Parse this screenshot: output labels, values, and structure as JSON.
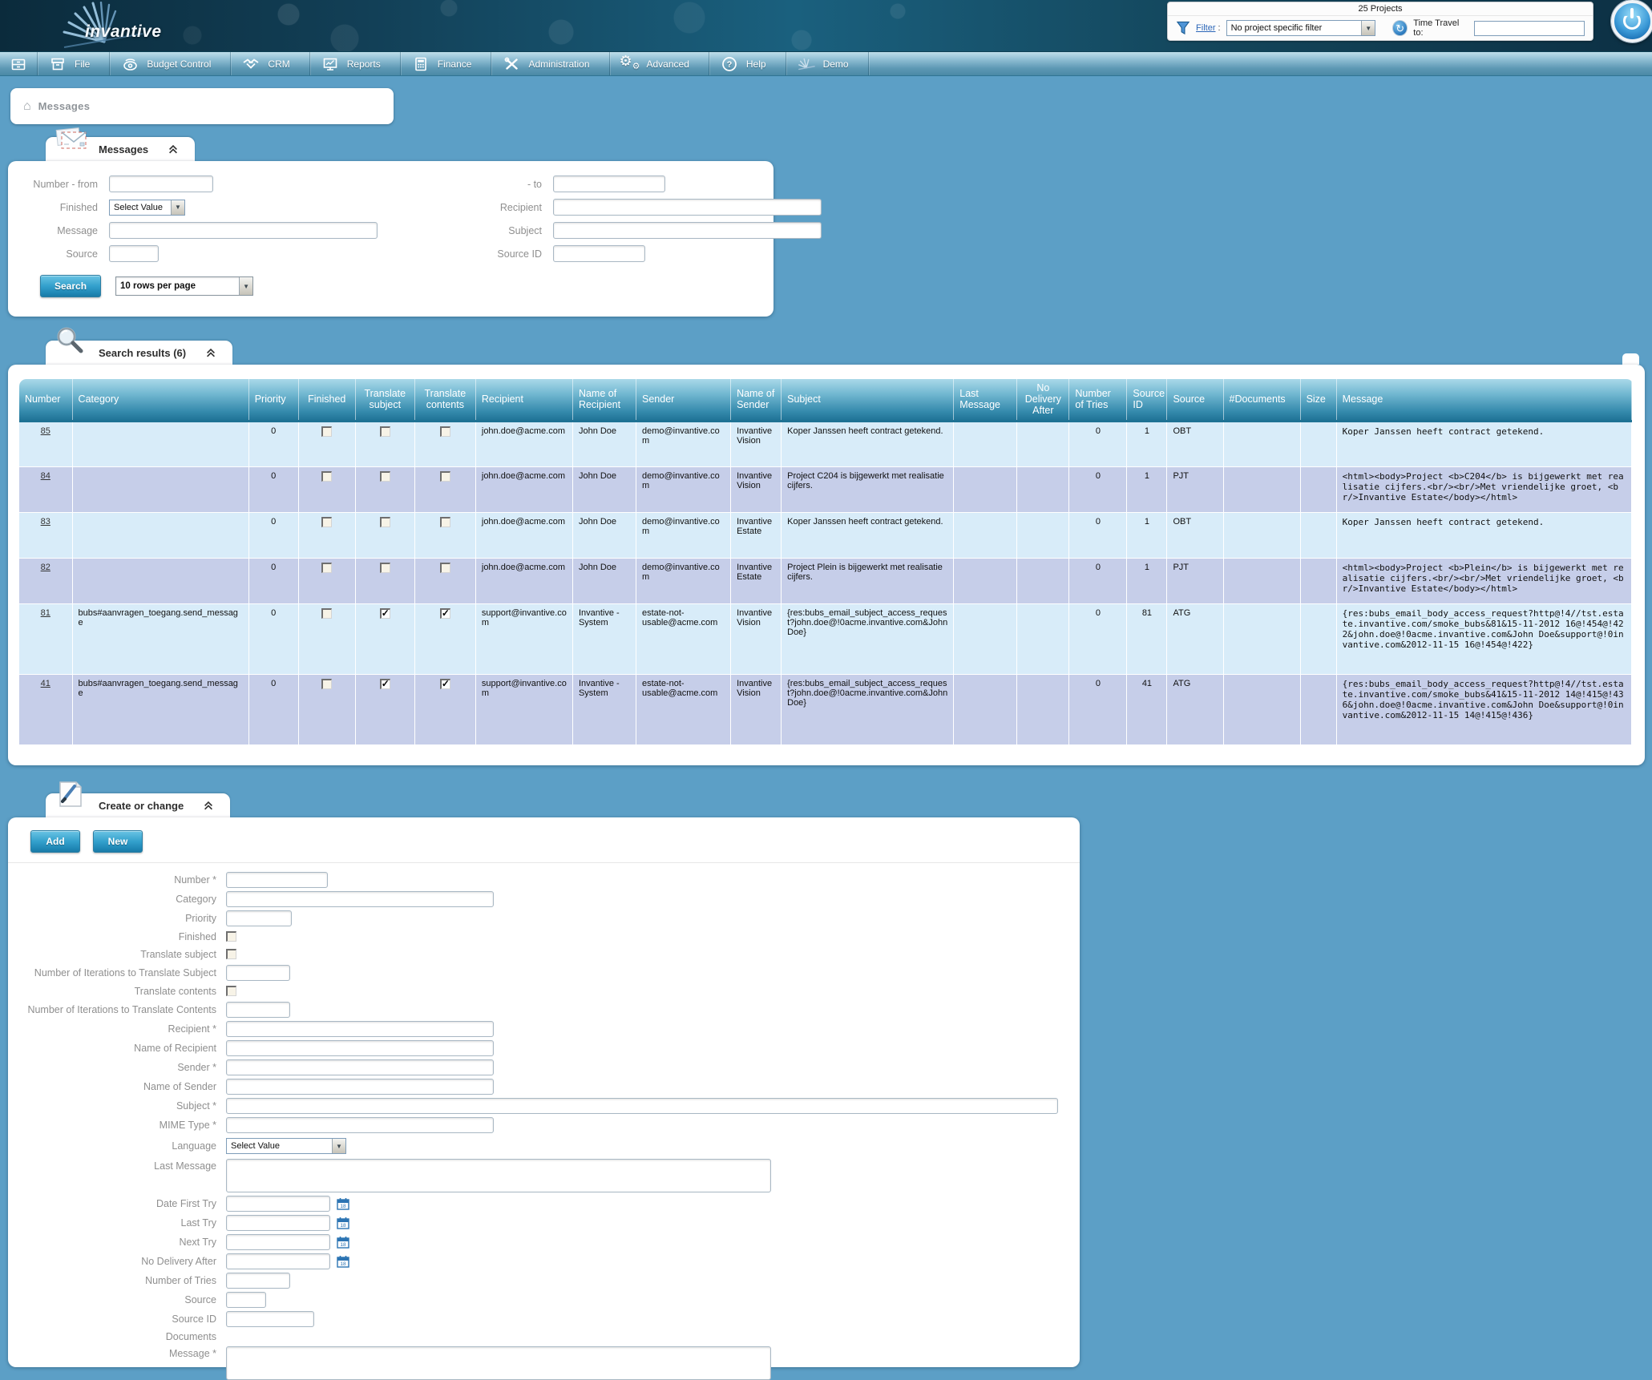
{
  "header": {
    "logo_text": "invantive",
    "projects_count": "25 Projects",
    "filter_label": "Filter",
    "filter_colon": ":",
    "filter_value": "No project specific filter",
    "time_travel_label": "Time Travel to:",
    "time_travel_value": ""
  },
  "menu": {
    "items": [
      {
        "label": "File",
        "icon": "file-icon"
      },
      {
        "label": "Budget Control",
        "icon": "budget-control-icon"
      },
      {
        "label": "CRM",
        "icon": "crm-icon"
      },
      {
        "label": "Reports",
        "icon": "reports-icon"
      },
      {
        "label": "Finance",
        "icon": "finance-icon"
      },
      {
        "label": "Administration",
        "icon": "administration-icon"
      },
      {
        "label": "Advanced",
        "icon": "advanced-icon"
      },
      {
        "label": "Help",
        "icon": "help-icon"
      },
      {
        "label": "Demo",
        "icon": "demo-icon"
      }
    ]
  },
  "breadcrumb": {
    "label": "Messages"
  },
  "search_panel": {
    "title": "Messages",
    "number_from_label": "Number - from",
    "to_label": "- to",
    "finished_label": "Finished",
    "finished_value": "Select Value",
    "recipient_label": "Recipient",
    "message_label": "Message",
    "subject_label": "Subject",
    "source_label": "Source",
    "source_id_label": "Source ID",
    "search_button": "Search",
    "rows_per_page": "10 rows per page"
  },
  "results_panel": {
    "title": "Search results (6)",
    "columns": [
      "Number",
      "Category",
      "Priority",
      "Finished",
      "Translate subject",
      "Translate contents",
      "Recipient",
      "Name of Recipient",
      "Sender",
      "Name of Sender",
      "Subject",
      "Last Message",
      "No Delivery After",
      "Number of Tries",
      "Source ID",
      "Source",
      "#Documents",
      "Size",
      "Message"
    ],
    "rows": [
      {
        "number": "85",
        "category": "",
        "priority": "0",
        "finished": false,
        "translate_subject": false,
        "translate_contents": false,
        "recipient": "john.doe@acme.com",
        "name_of_recipient": "John Doe",
        "sender": "demo@invantive.com",
        "name_of_sender": "Invantive Vision",
        "subject": "Koper Janssen heeft contract getekend.",
        "last_message": "",
        "no_delivery_after": "",
        "number_of_tries": "0",
        "source_id": "1",
        "source": "OBT",
        "documents": "",
        "size": "",
        "message": "Koper Janssen heeft contract getekend."
      },
      {
        "number": "84",
        "category": "",
        "priority": "0",
        "finished": false,
        "translate_subject": false,
        "translate_contents": false,
        "recipient": "john.doe@acme.com",
        "name_of_recipient": "John Doe",
        "sender": "demo@invantive.com",
        "name_of_sender": "Invantive Vision",
        "subject": "Project C204 is bijgewerkt met realisatie cijfers.",
        "last_message": "",
        "no_delivery_after": "",
        "number_of_tries": "0",
        "source_id": "1",
        "source": "PJT",
        "documents": "",
        "size": "",
        "message": "<html><body>Project <b>C204</b> is bijgewerkt met realisatie cijfers.<br/><br/>Met vriendelijke groet, <br/>Invantive Estate</body></html>"
      },
      {
        "number": "83",
        "category": "",
        "priority": "0",
        "finished": false,
        "translate_subject": false,
        "translate_contents": false,
        "recipient": "john.doe@acme.com",
        "name_of_recipient": "John Doe",
        "sender": "demo@invantive.com",
        "name_of_sender": "Invantive Estate",
        "subject": "Koper Janssen heeft contract getekend.",
        "last_message": "",
        "no_delivery_after": "",
        "number_of_tries": "0",
        "source_id": "1",
        "source": "OBT",
        "documents": "",
        "size": "",
        "message": "Koper Janssen heeft contract getekend."
      },
      {
        "number": "82",
        "category": "",
        "priority": "0",
        "finished": false,
        "translate_subject": false,
        "translate_contents": false,
        "recipient": "john.doe@acme.com",
        "name_of_recipient": "John Doe",
        "sender": "demo@invantive.com",
        "name_of_sender": "Invantive Estate",
        "subject": "Project Plein is bijgewerkt met realisatie cijfers.",
        "last_message": "",
        "no_delivery_after": "",
        "number_of_tries": "0",
        "source_id": "1",
        "source": "PJT",
        "documents": "",
        "size": "",
        "message": "<html><body>Project <b>Plein</b> is bijgewerkt met realisatie cijfers.<br/><br/>Met vriendelijke groet, <br/>Invantive Estate</body></html>"
      },
      {
        "number": "81",
        "category": "bubs#aanvragen_toegang.send_message",
        "priority": "0",
        "finished": false,
        "translate_subject": true,
        "translate_contents": true,
        "recipient": "support@invantive.com",
        "name_of_recipient": "Invantive - System",
        "sender": "estate-not-usable@acme.com",
        "name_of_sender": "Invantive Vision",
        "subject": "{res:bubs_email_subject_access_request?john.doe@!0acme.invantive.com&John Doe}",
        "last_message": "",
        "no_delivery_after": "",
        "number_of_tries": "0",
        "source_id": "81",
        "source": "ATG",
        "documents": "",
        "size": "",
        "message": "{res:bubs_email_body_access_request?http@!4//tst.estate.invantive.com/smoke_bubs&81&15-11-2012 16@!454@!422&john.doe@!0acme.invantive.com&John Doe&support@!0invantive.com&2012-11-15 16@!454@!422}"
      },
      {
        "number": "41",
        "category": "bubs#aanvragen_toegang.send_message",
        "priority": "0",
        "finished": false,
        "translate_subject": true,
        "translate_contents": true,
        "recipient": "support@invantive.com",
        "name_of_recipient": "Invantive - System",
        "sender": "estate-not-usable@acme.com",
        "name_of_sender": "Invantive Vision",
        "subject": "{res:bubs_email_subject_access_request?john.doe@!0acme.invantive.com&John Doe}",
        "last_message": "",
        "no_delivery_after": "",
        "number_of_tries": "0",
        "source_id": "41",
        "source": "ATG",
        "documents": "",
        "size": "",
        "message": "{res:bubs_email_body_access_request?http@!4//tst.estate.invantive.com/smoke_bubs&41&15-11-2012 14@!415@!436&john.doe@!0acme.invantive.com&John Doe&support@!0invantive.com&2012-11-15 14@!415@!436}"
      }
    ]
  },
  "create_panel": {
    "title": "Create or change",
    "add_button": "Add",
    "new_button": "New",
    "labels": {
      "number": "Number *",
      "category": "Category",
      "priority": "Priority",
      "finished": "Finished",
      "translate_subject": "Translate subject",
      "iterations_subject": "Number of Iterations to Translate Subject",
      "translate_contents": "Translate contents",
      "iterations_contents": "Number of Iterations to Translate Contents",
      "recipient": "Recipient *",
      "name_of_recipient": "Name of Recipient",
      "sender": "Sender *",
      "name_of_sender": "Name of Sender",
      "subject": "Subject *",
      "mime_type": "MIME Type *",
      "language": "Language",
      "language_value": "Select Value",
      "last_message": "Last Message",
      "date_first_try": "Date First Try",
      "last_try": "Last Try",
      "next_try": "Next Try",
      "no_delivery_after": "No Delivery After",
      "number_of_tries": "Number of Tries",
      "source": "Source",
      "source_id": "Source ID",
      "documents": "Documents",
      "message": "Message *"
    }
  }
}
